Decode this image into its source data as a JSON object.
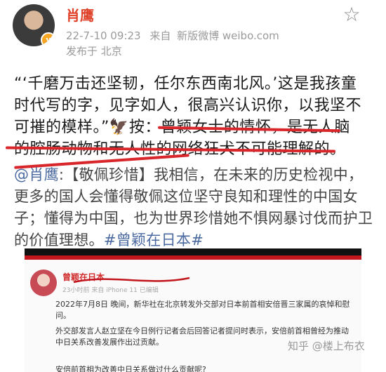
{
  "post": {
    "author": "肖鹰",
    "verified_badge": "v",
    "timestamp": "22-7-10 09:23",
    "source_prefix": "来自",
    "source": "新版微博 weibo.com",
    "location": "发布于 北京",
    "favorite_icon": "star-outline-icon"
  },
  "content": {
    "quote_line1": "“‘千磨万击还坚韧，任尔东西南北风。’这是我孩童",
    "quote_line2": "时代写的字，见字如人，很高兴认识你，以我坚不",
    "quote_line3": "可摧的模样。”",
    "eagle": "🦅",
    "note_prefix": "按：",
    "note_line1": "曾颖女士的情怀，是无人脑",
    "note_line2": "的腔肠动物和无人性的网络狂犬不可能理解的。"
  },
  "repost": {
    "mention": "@肖鹰",
    "text": ":【敬佩珍惜】我相信，在未来的历史检视中，更多的国人会懂得敬佩这位坚守良知和理性的中国女子；懂得为中国，也为世界珍惜她不惧网暴讨伐而护卫的价值理想。",
    "hashtag": "#曾颖在日本#"
  },
  "embedded": {
    "author": "曾颖在日本",
    "time": "23小时前 来自 iPhone 11 已编辑",
    "para1": "2022年7月8日 晚间，新华社在北京转发外交部对日本前首相安倍晋三家属的哀悼和慰问。",
    "para2": "外交部发言人赵立坚在今日例行记者会后回答记者提问时表示，安倍前首相曾经为推动中日关系改善发展作出过贡献。",
    "question": "安倍前首相为改善中日关系做过什么贡献呢?"
  },
  "watermark": "知乎 @楼上布衣",
  "colors": {
    "author": "#e0432c",
    "underline": "#d8262b",
    "link": "#4a6aa0",
    "divider_red": "#c2161c"
  }
}
